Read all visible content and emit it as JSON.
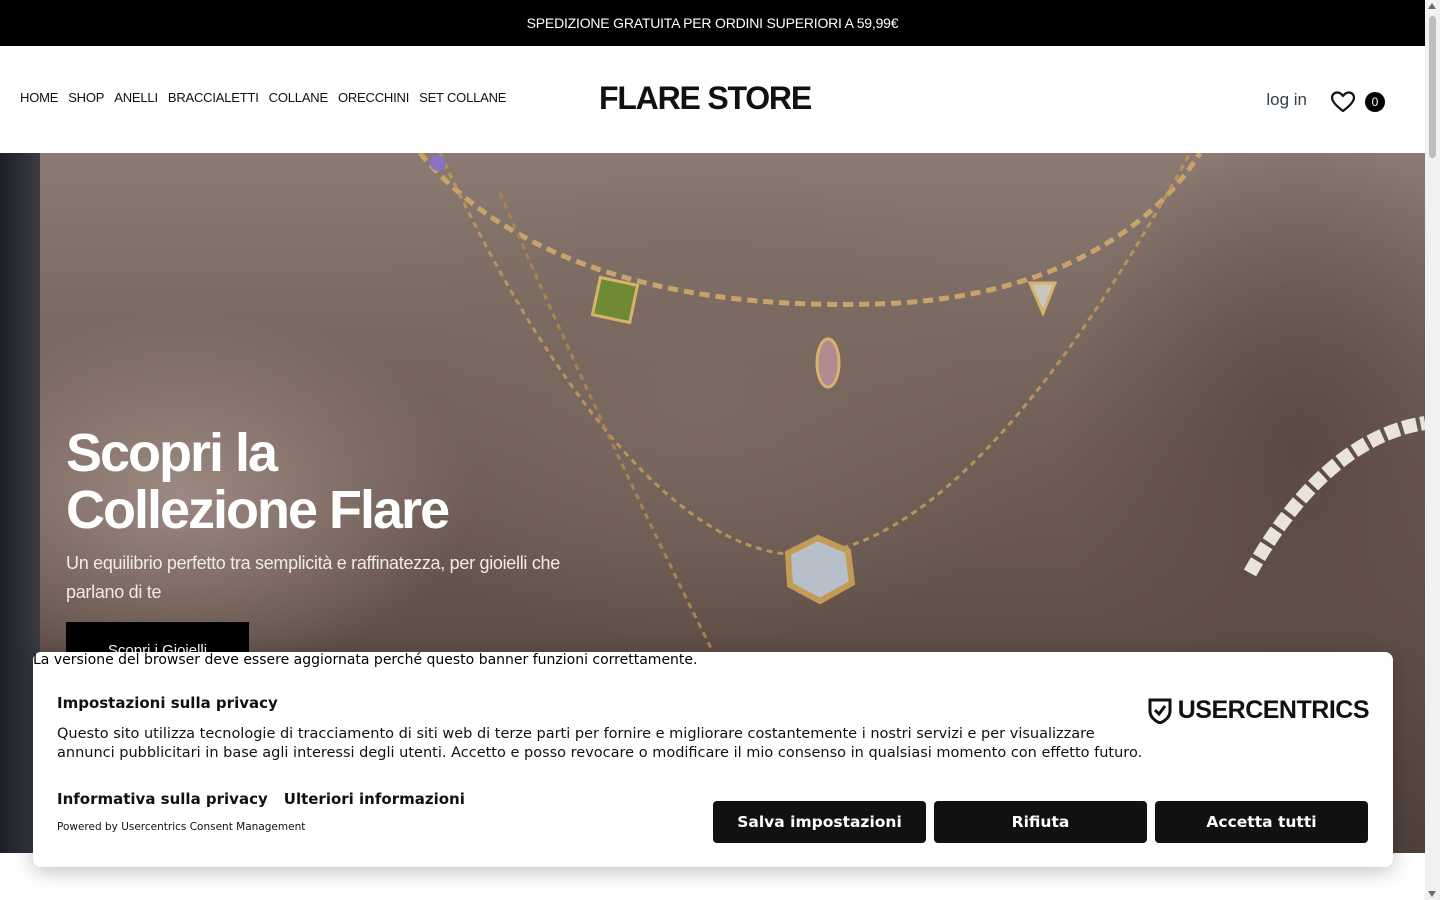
{
  "announcement": "SPEDIZIONE GRATUITA PER ORDINI SUPERIORI A 59,99€",
  "nav": [
    "HOME",
    "SHOP",
    "ANELLI",
    "BRACCIALETTI",
    "COLLANE",
    "ORECCHINI",
    "SET COLLANE"
  ],
  "brand": "FLARE STORE",
  "account": {
    "login": "log in",
    "cart_count": "0"
  },
  "icons": {
    "wishlist": "heart-icon",
    "usercentrics": "shield-check-icon"
  },
  "hero": {
    "title_line1": "Scopri la",
    "title_line2": "Collezione Flare",
    "subtitle": "Un equilibrio perfetto tra semplicità e raffinatezza, per gioielli che parlano di te",
    "cta": "Scopri i Gioielli"
  },
  "browser_warning": "La versione del browser deve essere aggiornata perché questo banner funzioni correttamente.",
  "cookie": {
    "title": "Impostazioni sulla privacy",
    "text": "Questo sito utilizza tecnologie di tracciamento di siti web di terze parti per fornire e migliorare costantemente i nostri servizi e per visualizzare annunci pubblicitari in base agli interessi degli utenti. Accetto e posso revocare o modificare il mio consenso in qualsiasi momento con effetto futuro.",
    "link_privacy": "Informativa sulla privacy",
    "link_more": "Ulteriori informazioni",
    "powered_by": "Powered by Usercentrics Consent Management",
    "logo_text": "USERCENTRICS",
    "btn_save": "Salva impostazioni",
    "btn_reject": "Rifiuta",
    "btn_accept": "Accetta tutti"
  }
}
